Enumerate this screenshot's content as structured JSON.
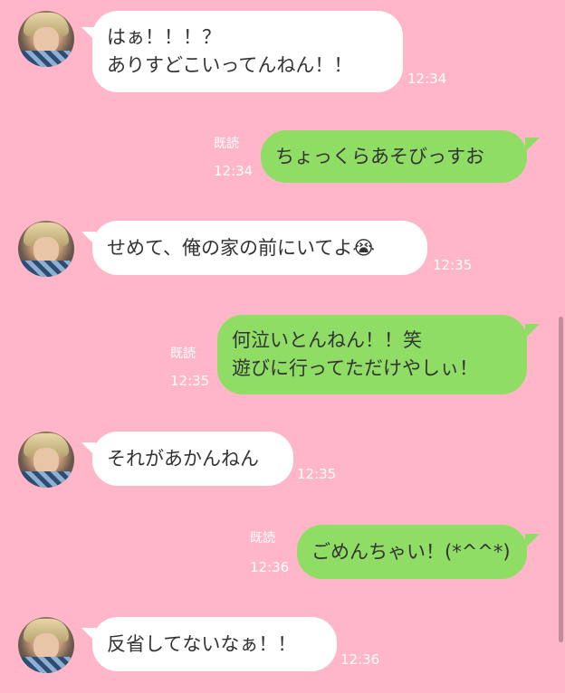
{
  "messages": [
    {
      "side": "in",
      "text": "はぁ！！！？\nありすどこいってんねん！！",
      "time": "12:34"
    },
    {
      "side": "out",
      "read": "既読",
      "text": "ちょっくらあそびっすお",
      "time": "12:34"
    },
    {
      "side": "in",
      "text": "せめて、俺の家の前にいてよ😭",
      "time": "12:35"
    },
    {
      "side": "out",
      "read": "既読",
      "text": "何泣いとんねん！！笑\n遊びに行ってただけやしぃ！",
      "time": "12:35"
    },
    {
      "side": "in",
      "text": "それがあかんねん",
      "time": "12:35"
    },
    {
      "side": "out",
      "read": "既読",
      "text": "ごめんちゃい！(*^^*)",
      "time": "12:36"
    },
    {
      "side": "in",
      "text": "反省してないなぁ！！",
      "time": "12:36"
    }
  ],
  "colors": {
    "background": "#ffb6c9",
    "incoming_bubble": "#ffffff",
    "outgoing_bubble": "#8fdd65",
    "message_text": "#333333",
    "meta_text": "#ffffff"
  },
  "icons": {
    "avatar": "avatar-photo"
  }
}
